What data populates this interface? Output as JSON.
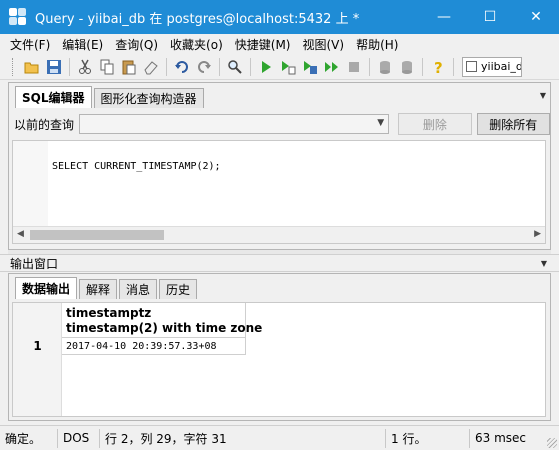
{
  "window": {
    "title": "Query - yiibai_db 在  postgres@localhost:5432 上 *",
    "minimize_glyph": "—",
    "maximize_glyph": "☐",
    "close_glyph": "✕"
  },
  "menu": [
    "文件(F)",
    "编辑(E)",
    "查询(Q)",
    "收藏夹(o)",
    "快捷键(M)",
    "视图(V)",
    "帮助(H)"
  ],
  "toolbar": {
    "database_combo": "yiibai_db"
  },
  "editor": {
    "tabs": [
      "SQL编辑器",
      "图形化查询构造器"
    ],
    "previous_queries_label": "以前的查询",
    "previous_queries_value": "",
    "delete_button": "删除",
    "delete_all_button": "删除所有",
    "code": "SELECT CURRENT_TIMESTAMP(2);"
  },
  "output": {
    "header": "输出窗口",
    "tabs": [
      "数据输出",
      "解释",
      "消息",
      "历史"
    ],
    "columns": [
      {
        "name": "timestamptz",
        "type": "timestamp(2) with time zone"
      }
    ],
    "rows": [
      {
        "num": "1",
        "value": "2017-04-10 20:39:57.33+08"
      }
    ]
  },
  "status": {
    "state": "确定。",
    "line_ending": "DOS",
    "position": "行 2，列 29，字符 31",
    "rows": "1 行。",
    "time": "63 msec"
  },
  "colors": {
    "titlebar": "#1f8cd6",
    "window_bg": "#f0f0f0"
  }
}
